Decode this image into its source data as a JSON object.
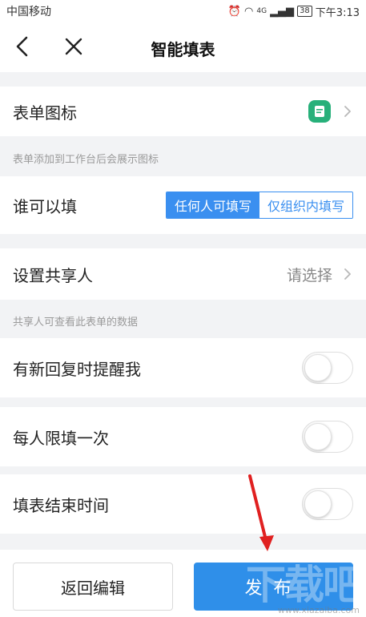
{
  "status_bar": {
    "carrier": "中国移动",
    "signal": "4G",
    "battery": "38",
    "time": "下午3:13"
  },
  "navbar": {
    "title": "智能填表"
  },
  "rows": {
    "form_icon": {
      "label": "表单图标",
      "hint": "表单添加到工作台后会展示图标"
    },
    "who_can_fill": {
      "label": "谁可以填",
      "options": [
        "任何人可填写",
        "仅组织内填写"
      ],
      "selected": "任何人可填写"
    },
    "sharer": {
      "label": "设置共享人",
      "placeholder": "请选择",
      "hint": "共享人可查看此表单的数据"
    },
    "notify_reply": {
      "label": "有新回复时提醒我",
      "enabled": false
    },
    "limit_once": {
      "label": "每人限填一次",
      "enabled": false
    },
    "end_time": {
      "label": "填表结束时间",
      "enabled": false
    }
  },
  "footer": {
    "back_label": "返回编辑",
    "publish_label": "发布"
  },
  "watermark": {
    "text": "www.xiazaiba.com",
    "logo": "下载吧"
  },
  "colors": {
    "accent": "#2f8fe9",
    "form_icon": "#27b07a",
    "annotation_arrow": "#e02020"
  }
}
